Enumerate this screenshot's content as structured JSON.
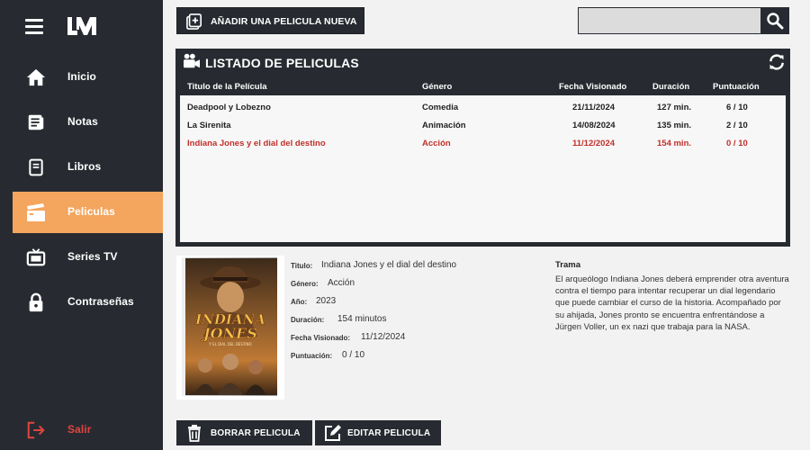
{
  "sidebar": {
    "logo_text": "LM",
    "items": [
      {
        "label": "Inicio",
        "icon": "home-icon"
      },
      {
        "label": "Notas",
        "icon": "notes-icon"
      },
      {
        "label": "Libros",
        "icon": "book-icon"
      },
      {
        "label": "Peliculas",
        "icon": "clapperboard-icon",
        "active": true
      },
      {
        "label": "Series TV",
        "icon": "tv-icon"
      },
      {
        "label": "Contraseñas",
        "icon": "lock-icon"
      }
    ],
    "exit_label": "Salir"
  },
  "toolbar": {
    "add_label": "AÑADIR UNA PELICULA NUEVA",
    "search_value": "",
    "search_placeholder": ""
  },
  "list": {
    "title": "LISTADO DE PELICULAS",
    "columns": [
      "Titulo de la Película",
      "Género",
      "Fecha Visionado",
      "Duración",
      "Puntuación"
    ],
    "rows": [
      {
        "title": "Deadpool y Lobezno",
        "genre": "Comedia",
        "date": "21/11/2024",
        "duration": "127 min.",
        "score": "6 / 10"
      },
      {
        "title": "La Sirenita",
        "genre": "Animación",
        "date": "14/08/2024",
        "duration": "135 min.",
        "score": "2 / 10"
      },
      {
        "title": "Indiana Jones y el dial del destino",
        "genre": "Acción",
        "date": "11/12/2024",
        "duration": "154 min.",
        "score": "0 / 10",
        "selected": true
      }
    ]
  },
  "detail": {
    "poster_title_line1": "INDIANA",
    "poster_title_line2": "JONES",
    "poster_subtitle": "Y EL DIAL DEL DESTINO",
    "title_label": "Titulo:",
    "title_value": "Indiana Jones y el dial del destino",
    "genre_label": "Género:",
    "genre_value": "Acción",
    "year_label": "Año:",
    "year_value": "2023",
    "duration_label": "Duración:",
    "duration_value": "154 minutos",
    "date_label": "Fecha Visionado:",
    "date_value": "11/12/2024",
    "score_label": "Puntuación:",
    "score_value": "0 / 10",
    "plot_title": "Trama",
    "plot_text": "El arqueólogo Indiana Jones deberá emprender otra aventura contra el tiempo para intentar recuperar un dial legendario que puede cambiar el curso de la historia. Acompañado por su ahijada, Jones pronto se encuentra enfrentándose a Jürgen Voller, un ex nazi que trabaja para la NASA."
  },
  "actions": {
    "delete_label": "BORRAR PELICULA",
    "edit_label": "EDITAR PELICULA"
  },
  "colors": {
    "sidebar_bg": "#272b31",
    "active_item": "#f4a55e",
    "selected_row": "#c0302a",
    "exit": "#e0453e"
  }
}
